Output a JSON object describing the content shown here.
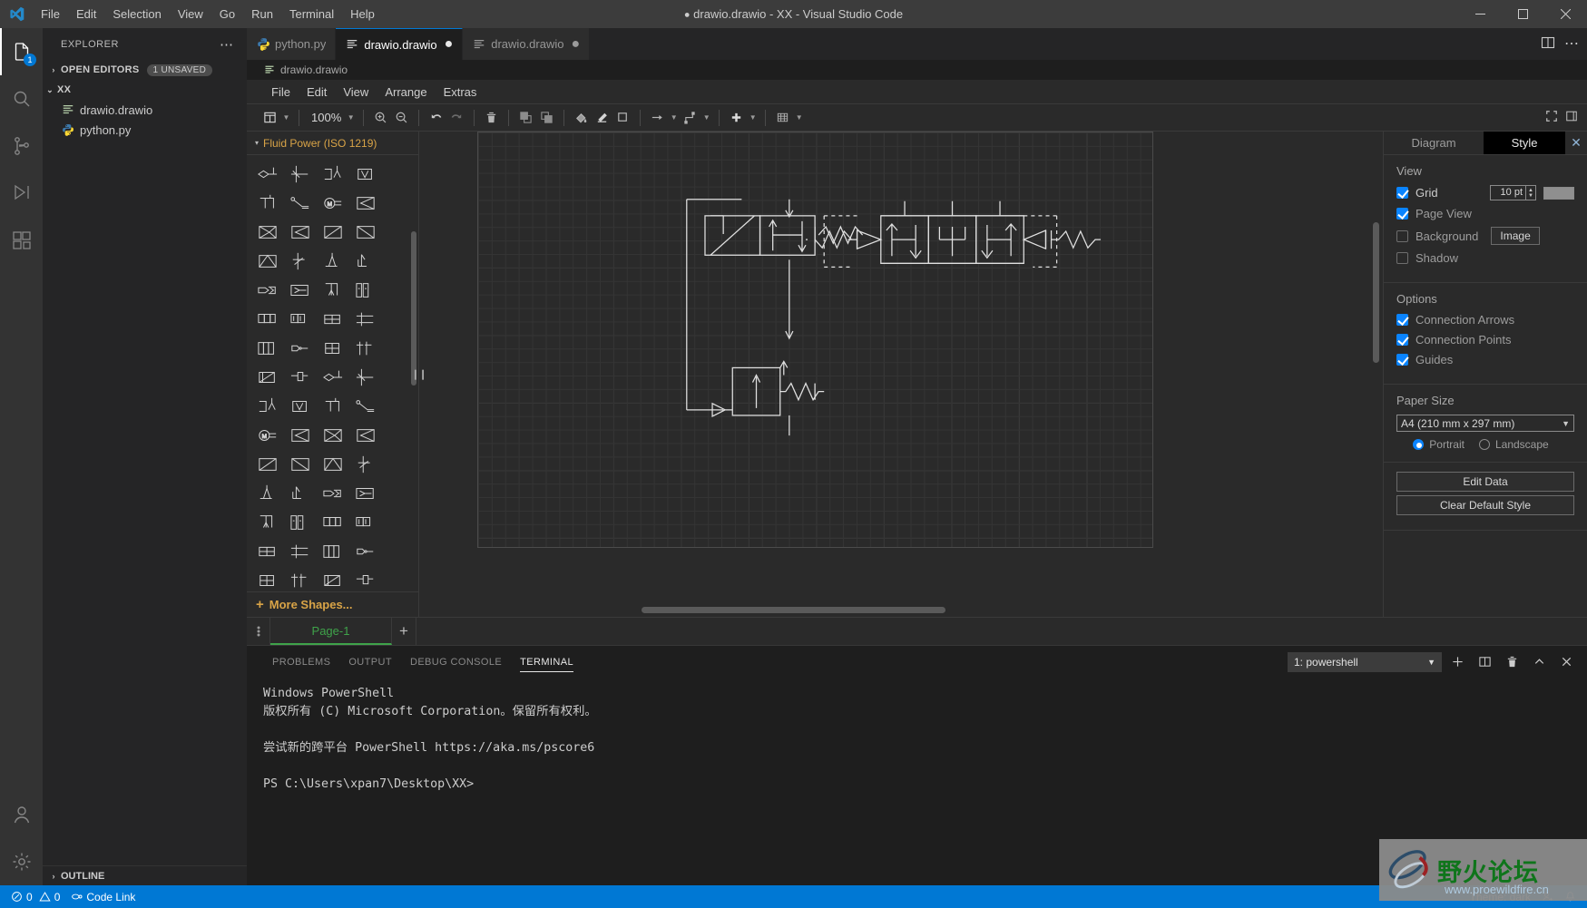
{
  "window": {
    "title": "drawio.drawio - XX - Visual Studio Code",
    "dirty_marker": "●",
    "menus": [
      "File",
      "Edit",
      "Selection",
      "View",
      "Go",
      "Run",
      "Terminal",
      "Help"
    ],
    "controls": {
      "minimize": "—",
      "maximize": "□",
      "close": "✕"
    }
  },
  "activitybar": {
    "items": [
      {
        "name": "explorer",
        "icon": "files-icon",
        "badge": "1"
      },
      {
        "name": "search",
        "icon": "search-icon",
        "badge": ""
      },
      {
        "name": "source-control",
        "icon": "source-control-icon",
        "badge": ""
      },
      {
        "name": "run-debug",
        "icon": "run-debug-icon",
        "badge": ""
      },
      {
        "name": "extensions",
        "icon": "extensions-icon",
        "badge": ""
      }
    ],
    "bottom": [
      {
        "name": "accounts",
        "icon": "account-icon"
      },
      {
        "name": "settings",
        "icon": "gear-icon"
      }
    ]
  },
  "sidebar": {
    "title": "EXPLORER",
    "more_actions": "⋯",
    "open_editors": {
      "label": "OPEN EDITORS",
      "badge": "1 UNSAVED",
      "twisty": "›"
    },
    "folder": {
      "label": "XX",
      "twisty": "⌄"
    },
    "files": [
      {
        "label": "drawio.drawio",
        "icon": "drawio-file-icon"
      },
      {
        "label": "python.py",
        "icon": "python-file-icon"
      }
    ],
    "outline": {
      "label": "OUTLINE",
      "twisty": "›"
    }
  },
  "editor": {
    "tabs": [
      {
        "label": "python.py",
        "icon": "python-file-icon",
        "dirty": "",
        "active": false
      },
      {
        "label": "drawio.drawio",
        "icon": "drawio-file-icon",
        "dirty": "●",
        "active": true
      },
      {
        "label": "drawio.drawio",
        "icon": "drawio-file-icon",
        "dirty": "●",
        "active": false
      }
    ],
    "actions": [
      {
        "name": "split-editor-icon"
      },
      {
        "name": "more-actions-icon"
      }
    ],
    "breadcrumb": {
      "label": "drawio.drawio",
      "icon": "drawio-file-icon"
    }
  },
  "drawio": {
    "menus": [
      "File",
      "Edit",
      "View",
      "Arrange",
      "Extras"
    ],
    "toolbar": {
      "view_icon": "view-layout-icon",
      "zoom_level": "100%",
      "buttons": [
        {
          "name": "zoom-in-button",
          "icon": "zoom-in-icon"
        },
        {
          "name": "zoom-out-button",
          "icon": "zoom-out-icon"
        },
        {
          "name": "undo-button",
          "icon": "undo-icon"
        },
        {
          "name": "redo-button",
          "icon": "redo-icon"
        },
        {
          "name": "delete-button",
          "icon": "trash-icon"
        },
        {
          "name": "to-front-button",
          "icon": "to-front-icon"
        },
        {
          "name": "to-back-button",
          "icon": "to-back-icon"
        },
        {
          "name": "fill-color-button",
          "icon": "fill-bucket-icon"
        },
        {
          "name": "line-color-button",
          "icon": "pencil-icon"
        },
        {
          "name": "shadow-button",
          "icon": "shadow-square-icon"
        },
        {
          "name": "connection-button",
          "icon": "arrow-right-icon"
        },
        {
          "name": "waypoints-button",
          "icon": "waypoint-icon"
        },
        {
          "name": "insert-button",
          "icon": "plus-icon"
        },
        {
          "name": "table-button",
          "icon": "table-grid-icon"
        }
      ],
      "right_buttons": [
        {
          "name": "fullscreen-button",
          "icon": "fullscreen-icon"
        },
        {
          "name": "format-panel-button",
          "icon": "format-panel-icon"
        }
      ]
    },
    "palette": {
      "section_title": "Fluid Power (ISO 1219)",
      "twisty": "▾",
      "more_shapes": {
        "plus": "+",
        "label": "More Shapes..."
      },
      "rows": 14,
      "cols": 5
    },
    "footer": {
      "menu_icon": "page-menu-icon",
      "pages": [
        "Page-1"
      ],
      "add_page": "+"
    },
    "format": {
      "tabs": [
        {
          "label": "Diagram",
          "active": false
        },
        {
          "label": "Style",
          "active": true
        }
      ],
      "close": "✕",
      "view": {
        "heading": "View",
        "grid": {
          "label": "Grid",
          "checked": true,
          "size": "10 pt",
          "color": "#8f8f8f"
        },
        "page_view": {
          "label": "Page View",
          "checked": true
        },
        "background": {
          "label": "Background",
          "checked": false,
          "button": "Image"
        },
        "shadow": {
          "label": "Shadow",
          "checked": false
        }
      },
      "options": {
        "heading": "Options",
        "items": [
          {
            "label": "Connection Arrows",
            "checked": true
          },
          {
            "label": "Connection Points",
            "checked": true
          },
          {
            "label": "Guides",
            "checked": true
          }
        ]
      },
      "paper": {
        "heading": "Paper Size",
        "selected": "A4 (210 mm x 297 mm)",
        "orientation": [
          {
            "label": "Portrait",
            "selected": true
          },
          {
            "label": "Landscape",
            "selected": false
          }
        ]
      },
      "buttons": [
        "Edit Data",
        "Clear Default Style"
      ]
    }
  },
  "panel": {
    "tabs": [
      {
        "label": "PROBLEMS",
        "active": false
      },
      {
        "label": "OUTPUT",
        "active": false
      },
      {
        "label": "DEBUG CONSOLE",
        "active": false
      },
      {
        "label": "TERMINAL",
        "active": true
      }
    ],
    "terminal_select": "1: powershell",
    "actions": [
      {
        "name": "new-terminal-button",
        "icon": "plus-icon"
      },
      {
        "name": "split-terminal-button",
        "icon": "split-icon"
      },
      {
        "name": "kill-terminal-button",
        "icon": "trash-icon"
      },
      {
        "name": "maximize-panel-button",
        "icon": "chevron-up-icon"
      },
      {
        "name": "close-panel-button",
        "icon": "close-icon"
      }
    ],
    "terminal_text": "Windows PowerShell\n版权所有 (C) Microsoft Corporation。保留所有权利。\n\n尝试新的跨平台 PowerShell https://aka.ms/pscore6\n\nPS C:\\Users\\xpan7\\Desktop\\XX> "
  },
  "statusbar": {
    "errors": "0",
    "warnings": "0",
    "code_link": "Code Link",
    "theme": "Theme: dark",
    "accent": "#0078d4"
  },
  "watermark": {
    "text": "野火论坛",
    "url": "www.proewildfire.cn"
  }
}
